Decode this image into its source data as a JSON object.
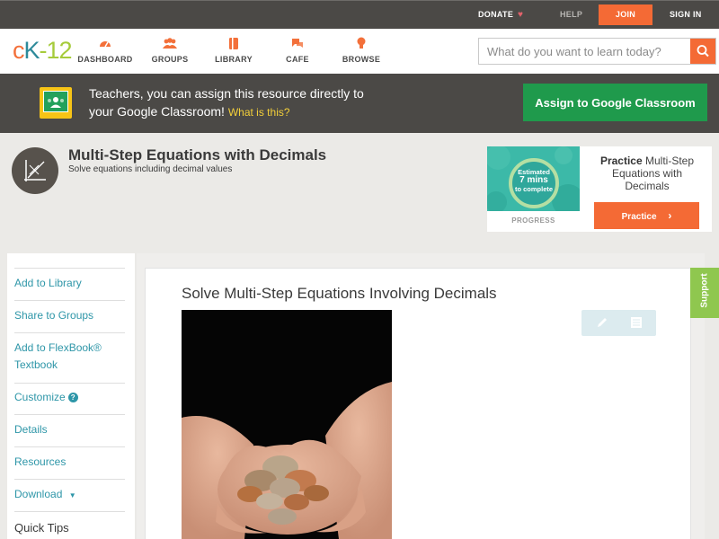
{
  "topbar": {
    "donate": "DONATE",
    "help": "HELP",
    "join": "JOIN",
    "signin": "SIGN IN"
  },
  "nav": {
    "logo": {
      "c": "c",
      "k": "K",
      "dash": "-",
      "num": "12"
    },
    "items": [
      {
        "label": "DASHBOARD",
        "icon": "dashboard-icon"
      },
      {
        "label": "GROUPS",
        "icon": "groups-icon"
      },
      {
        "label": "LIBRARY",
        "icon": "library-icon"
      },
      {
        "label": "CAFE",
        "icon": "cafe-icon"
      },
      {
        "label": "BROWSE",
        "icon": "browse-icon"
      }
    ],
    "search_placeholder": "What do you want to learn today?"
  },
  "banner": {
    "line1": "Teachers, you can assign this resource directly to",
    "line2": "your Google Classroom!",
    "link": "What is this?",
    "button": "Assign to Google Classroom"
  },
  "concept": {
    "title": "Multi-Step Equations with Decimals",
    "subtitle": "Solve equations including decimal values"
  },
  "practice": {
    "estimated": "Estimated",
    "mins": "7 mins",
    "to_complete": "to complete",
    "progress_label": "PROGRESS",
    "title_bold": "Practice",
    "title_rest": "Multi-Step Equations with Decimals",
    "button": "Practice"
  },
  "sidebar": {
    "items": [
      {
        "label": "Add to Library"
      },
      {
        "label": "Share to Groups"
      },
      {
        "label": "Add to FlexBook®"
      },
      {
        "label": "Textbook"
      },
      {
        "label": "Customize"
      },
      {
        "label": "Details"
      },
      {
        "label": "Resources"
      },
      {
        "label": "Download"
      }
    ],
    "quick_tips": "Quick Tips"
  },
  "content": {
    "title": "Solve Multi-Step Equations Involving Decimals"
  },
  "support_tab": "Support",
  "colors": {
    "accent_orange": "#f46a35",
    "teal_link": "#2e96a8",
    "classroom_green": "#1f9a4c",
    "dark_bar": "#4b4946",
    "support_green": "#8fc74f"
  }
}
